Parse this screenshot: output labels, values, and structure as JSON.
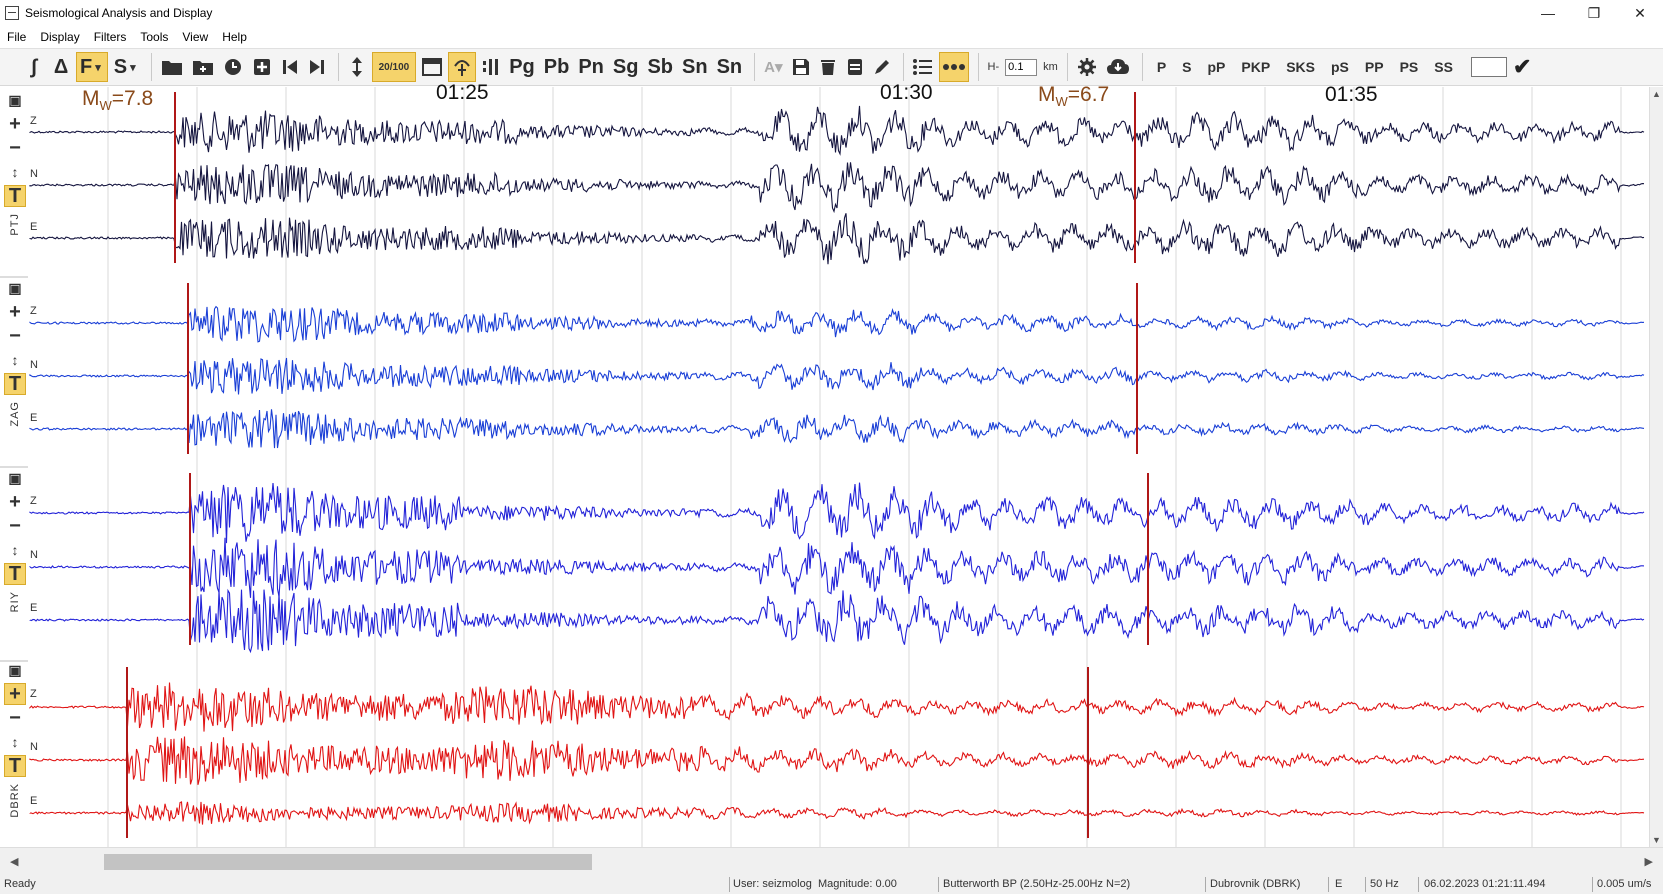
{
  "window": {
    "title": "Seismological Analysis and Display",
    "minimize": "—",
    "restore": "❐",
    "close": "✕"
  },
  "menu": [
    {
      "label": "File"
    },
    {
      "label": "Display"
    },
    {
      "label": "Filters"
    },
    {
      "label": "Tools"
    },
    {
      "label": "View"
    },
    {
      "label": "Help"
    }
  ],
  "toolbar": {
    "integrate": "∫",
    "differentiate": "Δ",
    "filter": "F",
    "filter_dropdown": "▾",
    "spectrum": "S",
    "spectrum_dropdown": "▾",
    "zoom_label": "20/100",
    "phases": [
      "Pg",
      "Pb",
      "Pn",
      "Sg",
      "Sb",
      "Sn",
      "Sn"
    ],
    "depth_prefix": "H-",
    "depth_value": "0.1",
    "depth_unit": "km",
    "phase_buttons": [
      "P",
      "S",
      "pP",
      "PKP",
      "SKS",
      "pS",
      "PP",
      "PS",
      "SS"
    ]
  },
  "plot": {
    "time_labels": [
      "01:25",
      "01:30",
      "01:35"
    ],
    "events": [
      {
        "prefix": "M",
        "sub": "W",
        "suffix": "=7.8"
      },
      {
        "prefix": "M",
        "sub": "W",
        "suffix": "=6.7"
      }
    ],
    "components": [
      "Z",
      "N",
      "E"
    ],
    "stations": [
      {
        "name": "PTJ",
        "color": "#15153f"
      },
      {
        "name": "ZAG",
        "color": "#1a3fd6"
      },
      {
        "name": "RIY",
        "color": "#2323d8"
      },
      {
        "name": "DBRK",
        "color": "#e01414"
      }
    ],
    "marker_color": "#b01818",
    "grid_color": "#d9d9d9"
  },
  "status": {
    "ready": "Ready",
    "user": "User: seizmolog",
    "magnitude": "Magnitude: 0.00",
    "filter": "Butterworth BP (2.50Hz-25.00Hz N=2)",
    "station": "Dubrovnik (DBRK)",
    "component": "E",
    "sample_rate": "50 Hz",
    "datetime": "06.02.2023 01:21:11.494",
    "amplitude": "0.005 um/s"
  }
}
